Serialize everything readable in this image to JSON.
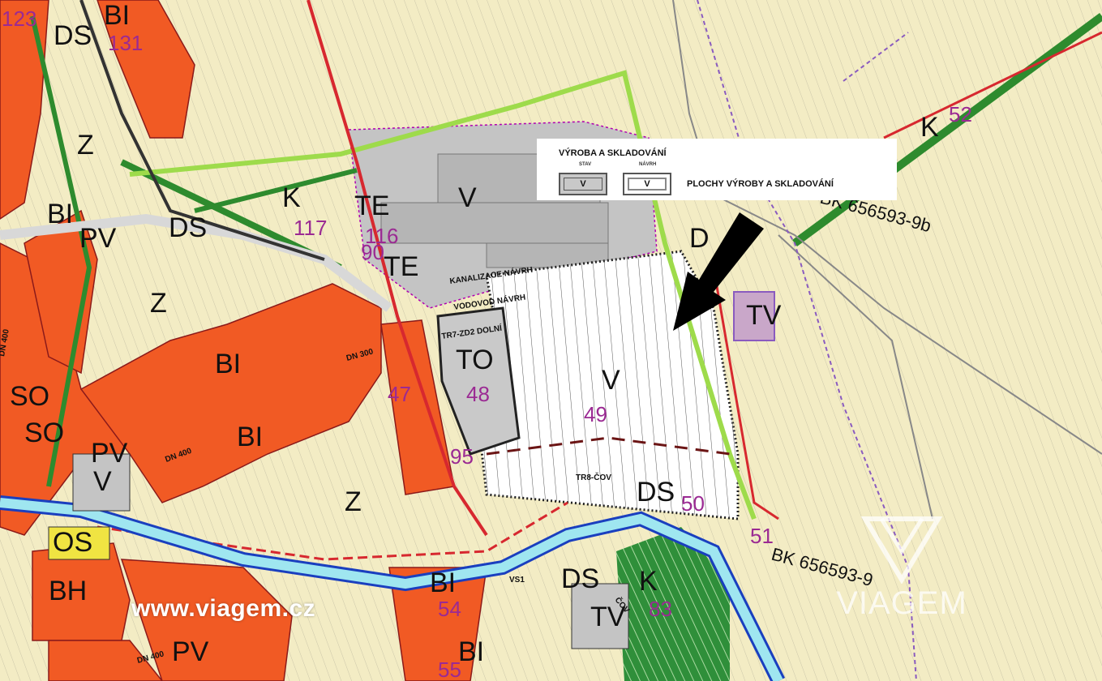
{
  "legend": {
    "title": "VÝROBA A SKLADOVÁNÍ",
    "header_stav": "STAV",
    "header_navrh": "NÁVRH",
    "stav_code": "V",
    "navrh_code": "V",
    "description": "PLOCHY VÝROBY A SKLADOVÁNÍ"
  },
  "zones": {
    "bi_top": "BI",
    "ds_top": "DS",
    "z_left": "Z",
    "bi_left": "BI",
    "pv_left": "PV",
    "ds_mid": "DS",
    "z_mid": "Z",
    "k_top": "K",
    "te_1": "TE",
    "te_2": "TE",
    "v_grey": "V",
    "bi_center": "BI",
    "bi_lower": "BI",
    "to_zone": "TO",
    "v_main": "V",
    "tv_zone": "TV",
    "ds_right": "D",
    "k_right": "K",
    "so_1": "SO",
    "so_2": "SO",
    "pv_lower": "PV",
    "v_small": "V",
    "z_lower": "Z",
    "os_zone": "OS",
    "bh_zone": "BH",
    "ds_bottom": "DS",
    "k_bottom": "K",
    "bi_bottom1": "BI",
    "bi_bottom2": "BI",
    "pv_bottom": "PV",
    "ds_right2": "DS",
    "tv_bottom": "TV"
  },
  "zone_numbers": {
    "n123": "123",
    "n131": "131",
    "n117": "117",
    "n116": "116",
    "n90": "90",
    "n48": "48",
    "n49": "49",
    "n95": "95",
    "n50": "50",
    "n51": "51",
    "n83": "83",
    "n54": "54",
    "n55": "55",
    "n52": "52",
    "n47": "47"
  },
  "annotations": {
    "kanalizace": "KANALIZACE NÁVRH",
    "vodovod": "VODOVOD NÁVRH",
    "tr7": "TR7-ZD2 DOLNÍ",
    "tr8": "TR8-ČOV",
    "dn300": "DN 300",
    "dn400a": "DN 400",
    "dn400b": "DN 400",
    "dn400c": "DN 400",
    "cov": "ČOV",
    "vs1": "VS1"
  },
  "references": {
    "ref_9b": "BK 656593-9b",
    "ref_9": "BK 656593-9"
  },
  "watermark": {
    "url": "www.viagem.cz",
    "brand": "VIAGEM"
  },
  "colors": {
    "background": "#f3ecc4",
    "residential": "#f15a24",
    "production": "#c4c4c4",
    "greenery": "#2e8b2e",
    "road": "#d8d8d8",
    "water": "#9fe6f0",
    "boundary": "#d7282f",
    "purple": "#8a5bbf"
  }
}
